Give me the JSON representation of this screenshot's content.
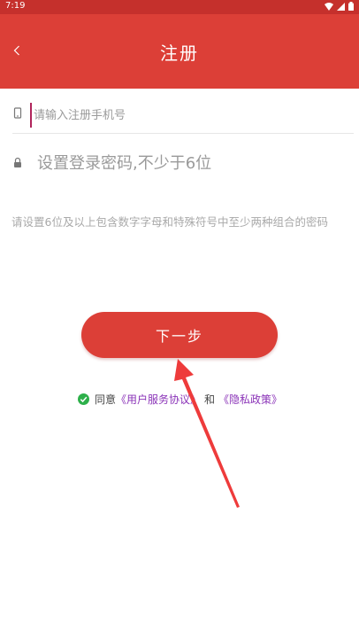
{
  "statusbar": {
    "time": "7:19"
  },
  "header": {
    "title": "注册"
  },
  "form": {
    "phone_placeholder": "请输入注册手机号",
    "password_placeholder": "设置登录密码,不少于6位",
    "hint": "请设置6位及以上包含数字字母和特殊符号中至少两种组合的密码"
  },
  "actions": {
    "next_label": "下一步"
  },
  "agreement": {
    "prefix": "同意",
    "service_link": "《用户服务协议》",
    "and": "和",
    "privacy_link": "《隐私政策》"
  },
  "colors": {
    "accent": "#dc3f37",
    "link": "#8b34b8",
    "check": "#2db04a"
  }
}
